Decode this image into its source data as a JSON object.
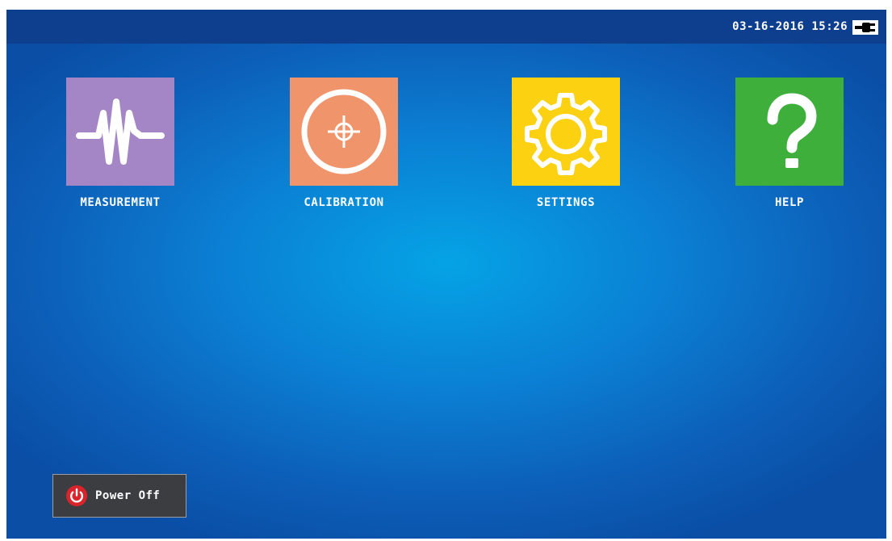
{
  "status_bar": {
    "datetime": "03-16-2016 15:26",
    "power_source_icon": "ac-plug-icon"
  },
  "apps": [
    {
      "label": "MEASUREMENT",
      "icon": "waveform-icon",
      "color": "#a486c6"
    },
    {
      "label": "CALIBRATION",
      "icon": "crosshair-icon",
      "color": "#f0956b"
    },
    {
      "label": "SETTINGS",
      "icon": "gear-icon",
      "color": "#fcd112"
    },
    {
      "label": "HELP",
      "icon": "question-mark-icon",
      "color": "#3daf3a"
    }
  ],
  "power_button": {
    "label": "Power Off",
    "icon": "power-icon"
  },
  "colors": {
    "status_bar": "#0e3f8e",
    "background_center": "#05a3e6",
    "background_edge": "#0a4ea6",
    "power_icon": "#d9242b"
  }
}
